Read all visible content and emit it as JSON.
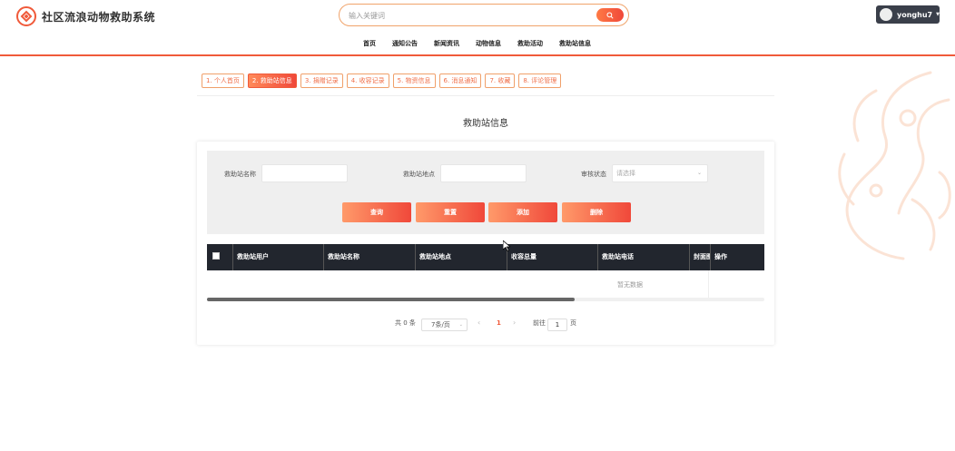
{
  "app": {
    "title": "社区流浪动物救助系统"
  },
  "search": {
    "placeholder": "输入关键词"
  },
  "user": {
    "name": "yonghu7"
  },
  "nav": {
    "items": [
      "首页",
      "通知公告",
      "新闻资讯",
      "动物信息",
      "救助活动",
      "救助站信息"
    ]
  },
  "tabs": {
    "items": [
      "1. 个人首页",
      "2. 救助站信息",
      "3. 捐赠记录",
      "4. 收容记录",
      "5. 物资信息",
      "6. 消息通知",
      "7. 收藏",
      "8. 评论管理"
    ],
    "active_index": 1
  },
  "page": {
    "title": "救助站信息"
  },
  "filter": {
    "name_label": "救助站名称",
    "location_label": "救助站地点",
    "status_label": "审核状态",
    "status_placeholder": "请选择",
    "buttons": {
      "query": "查询",
      "reset": "重置",
      "add": "添加",
      "delete": "删除"
    }
  },
  "table": {
    "columns": [
      "救助站用户",
      "救助站名称",
      "救助站地点",
      "收容总量",
      "救助站电话",
      "封面图",
      "操作"
    ],
    "empty_text": "暂无数据",
    "rows": []
  },
  "pagination": {
    "total_text": "共 0 条",
    "page_size": "7条/页",
    "current_page": "1",
    "jump_prefix": "前往",
    "jump_value": "1",
    "jump_suffix": "页"
  },
  "colors": {
    "accent": "#f05a3a",
    "accent_light": "#ff8a5a",
    "table_header": "#22262e"
  }
}
